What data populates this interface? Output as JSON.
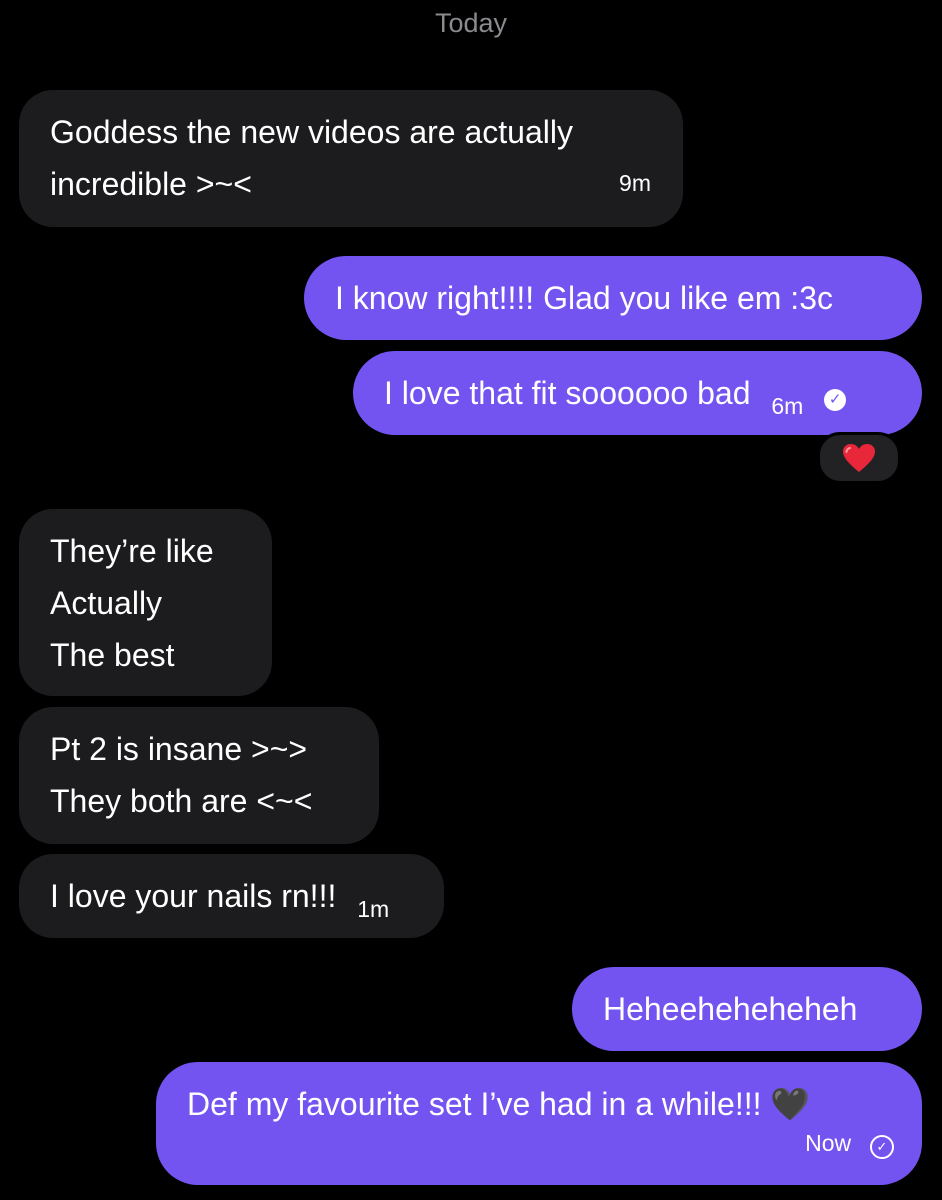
{
  "date_separator": "Today",
  "messages": [
    {
      "lines": [
        "Goddess the new videos are actually",
        "incredible >~<"
      ],
      "time": "9m"
    },
    {
      "text": "I know right!!!! Glad you like em :3c"
    },
    {
      "text": "I love that fit soooooo bad",
      "time": "6m",
      "reaction": "❤️"
    },
    {
      "lines": [
        "They’re like",
        "Actually",
        "The best"
      ]
    },
    {
      "lines": [
        "Pt 2 is insane >~>",
        "They both are <~<"
      ]
    },
    {
      "text": "I love your nails rn!!!",
      "time": "1m"
    },
    {
      "text": "Heheeheheheheh"
    },
    {
      "text": "Def my favourite set I’ve had in a while!!! 🖤",
      "time": "Now"
    }
  ],
  "colors": {
    "background": "#000000",
    "incoming_bubble": "#1c1c1e",
    "outgoing_bubble": "#7354f0",
    "date_text": "#8a8a8f"
  },
  "icons": {
    "read_receipt": "check-circle-icon",
    "reaction": "heart-emoji",
    "black_heart": "black-heart-emoji"
  }
}
